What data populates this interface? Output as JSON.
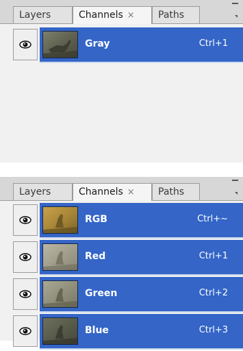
{
  "colors": {
    "selection": "#3465c7",
    "panel_bg": "#f1f1f1",
    "tabbar_bg": "#d7d7d7"
  },
  "panel_top": {
    "tabs": [
      {
        "label": "Layers"
      },
      {
        "label": "Channels",
        "close": "×"
      },
      {
        "label": "Paths"
      }
    ],
    "channels": [
      {
        "name": "Gray",
        "shortcut": "Ctrl+1",
        "thumbnail": "gray-deer-thumbnail"
      }
    ]
  },
  "panel_bottom": {
    "tabs": [
      {
        "label": "Layers"
      },
      {
        "label": "Channels",
        "close": "×"
      },
      {
        "label": "Paths"
      }
    ],
    "channels": [
      {
        "name": "RGB",
        "shortcut": "Ctrl+~",
        "thumbnail": "rgb-deer-thumbnail"
      },
      {
        "name": "Red",
        "shortcut": "Ctrl+1",
        "thumbnail": "red-deer-thumbnail"
      },
      {
        "name": "Green",
        "shortcut": "Ctrl+2",
        "thumbnail": "green-deer-thumbnail"
      },
      {
        "name": "Blue",
        "shortcut": "Ctrl+3",
        "thumbnail": "blue-deer-thumbnail"
      }
    ]
  }
}
